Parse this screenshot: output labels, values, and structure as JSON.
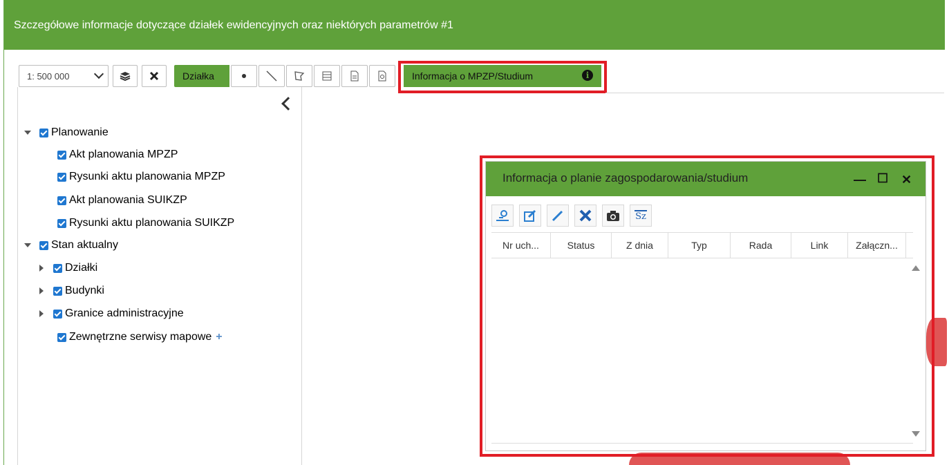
{
  "window": {
    "title": "Szczegółowe informacje dotyczące działek ewidencyjnych oraz niektórych parametrów #1"
  },
  "toolbar": {
    "scale_value": "1: 500 000",
    "dzialka_label": "Działka",
    "mpzp_label": "Informacja o MPZP/Studium",
    "info_glyph": "i"
  },
  "tree": {
    "planowanie": "Planowanie",
    "items_planowanie": [
      "Akt planowania MPZP",
      "Rysunki aktu planowania MPZP",
      "Akt planowania SUIKZP",
      "Rysunki aktu planowania SUIKZP"
    ],
    "stan": "Stan aktualny",
    "dzialki": "Działki",
    "budynki": "Budynki",
    "granice": "Granice administracyjne",
    "zewnetrzne": "Zewnętrzne serwisy mapowe",
    "plus": "+"
  },
  "dialog": {
    "title": "Informacja o planie zagospodarowania/studium",
    "minimize": "—",
    "maximize": "☐",
    "close": "✕",
    "columns": [
      "Nr uch...",
      "Status",
      "Z dnia",
      "Typ",
      "Rada",
      "Link",
      "Załączn..."
    ],
    "sz_label": "Sz"
  },
  "colors": {
    "accent_green": "#5fa13a",
    "highlight_red": "#e11d26",
    "checkbox_blue": "#1f77d0"
  }
}
